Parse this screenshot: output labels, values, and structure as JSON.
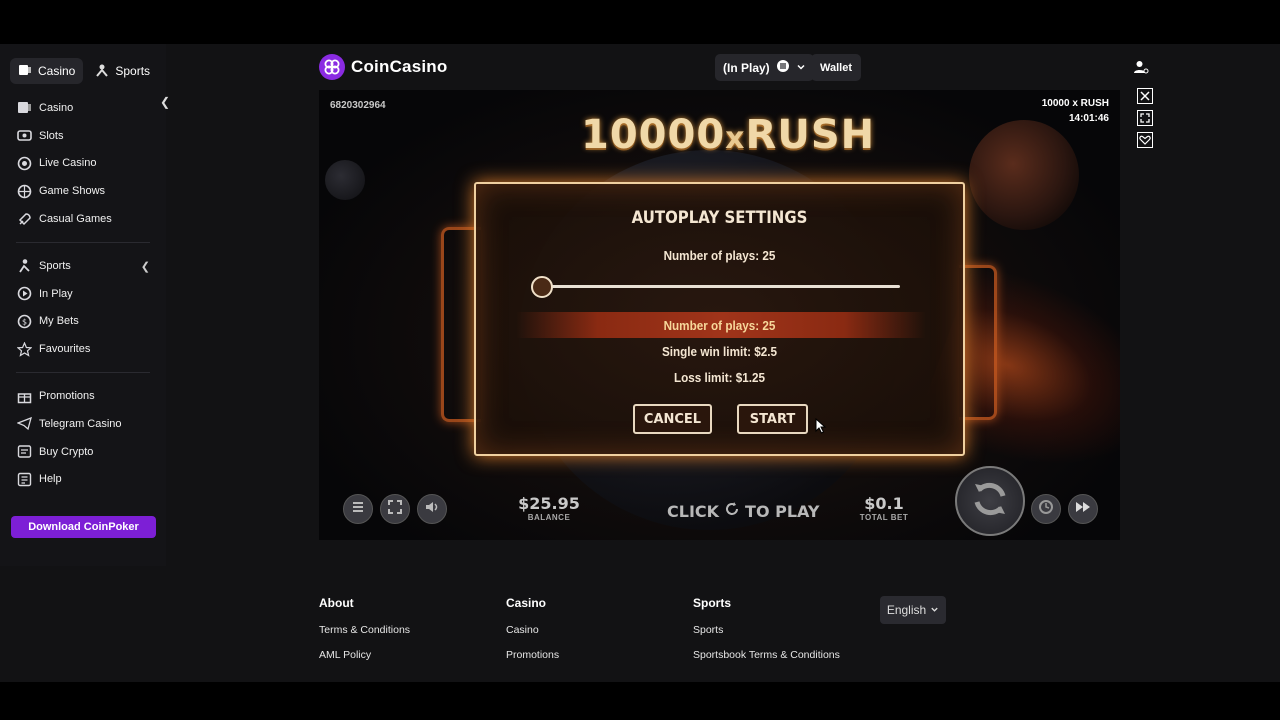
{
  "header": {
    "logo_text": "CoinCasino",
    "inplay_label": "(In Play)",
    "wallet_label": "Wallet"
  },
  "sidebar": {
    "tabs": [
      {
        "label": "Casino"
      },
      {
        "label": "Sports"
      }
    ],
    "items": [
      {
        "label": "Casino",
        "icon": "casino-icon"
      },
      {
        "label": "Slots",
        "icon": "slots-icon"
      },
      {
        "label": "Live Casino",
        "icon": "live-casino-icon"
      },
      {
        "label": "Game Shows",
        "icon": "game-shows-icon"
      },
      {
        "label": "Casual Games",
        "icon": "rocket-icon"
      }
    ],
    "sports_items": [
      {
        "label": "Sports",
        "icon": "sports-icon"
      },
      {
        "label": "In Play",
        "icon": "play-icon"
      },
      {
        "label": "My Bets",
        "icon": "bets-icon"
      },
      {
        "label": "Favourites",
        "icon": "star-icon"
      }
    ],
    "extra_items": [
      {
        "label": "Promotions",
        "icon": "gift-icon"
      },
      {
        "label": "Telegram Casino",
        "icon": "telegram-icon"
      },
      {
        "label": "Buy Crypto",
        "icon": "crypto-icon"
      },
      {
        "label": "Help",
        "icon": "help-icon"
      }
    ],
    "download_label": "Download CoinPoker"
  },
  "game": {
    "id": "6820302964",
    "title": "10000 x RUSH",
    "time": "14:01:46",
    "logo_main": "10000",
    "logo_x": "x",
    "logo_rush": "RUSH",
    "balance_value": "$25.95",
    "balance_label": "BALANCE",
    "click_to_play_left": "CLICK",
    "click_to_play_right": "TO PLAY",
    "total_bet_value": "$0.1",
    "total_bet_label": "TOTAL BET"
  },
  "modal": {
    "title": "AUTOPLAY SETTINGS",
    "plays_label": "Number of plays: 25",
    "plays_value": 25,
    "summary_plays": "Number of plays: 25",
    "summary_win_limit": "Single win limit: $2.5",
    "summary_loss_limit": "Loss limit: $1.25",
    "cancel_label": "CANCEL",
    "start_label": "START"
  },
  "footer": {
    "about": {
      "title": "About",
      "links": [
        "Terms & Conditions",
        "AML Policy"
      ]
    },
    "casino": {
      "title": "Casino",
      "links": [
        "Casino",
        "Promotions"
      ]
    },
    "sports": {
      "title": "Sports",
      "links": [
        "Sports",
        "Sportsbook Terms & Conditions"
      ]
    },
    "language": "English"
  },
  "colors": {
    "brand_purple": "#8a2be2",
    "download_button": "#7d1fd6",
    "modal_glow": "#d87a2a"
  }
}
